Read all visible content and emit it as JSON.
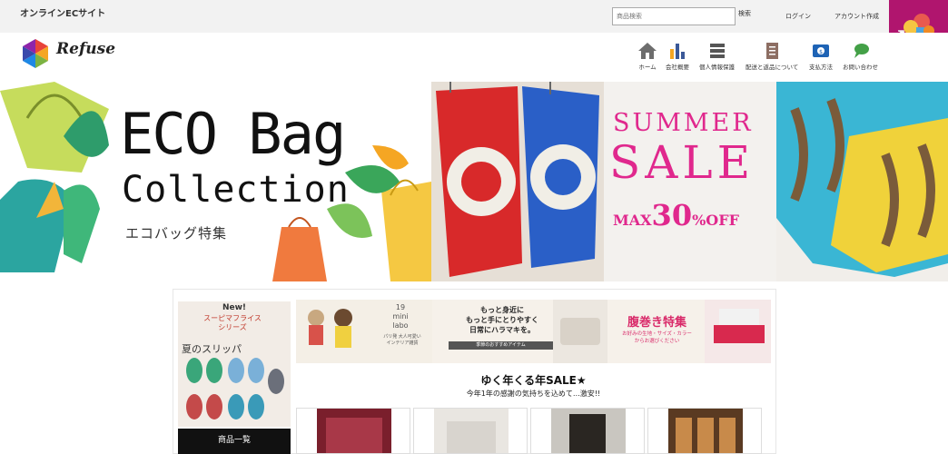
{
  "topbar": {
    "site_name": "オンラインECサイト",
    "search_placeholder": "商品検索",
    "search_button": "検索",
    "login": "ログイン",
    "signup": "アカウント作成"
  },
  "header": {
    "logo_text": "Refuse",
    "nav": [
      {
        "label": "ホーム",
        "icon": "home-icon"
      },
      {
        "label": "会社概要",
        "icon": "bar-chart-icon"
      },
      {
        "label": "個人情報保護",
        "icon": "list-icon"
      },
      {
        "label": "配送と返品について",
        "icon": "document-icon"
      },
      {
        "label": "支払方法",
        "icon": "payment-icon"
      },
      {
        "label": "お問い合わせ",
        "icon": "chat-icon"
      }
    ]
  },
  "banner": {
    "eco_title": "ECO Bag",
    "eco_subtitle": "Collection",
    "eco_jp": "エコバッグ特集",
    "summer": "SUMMER",
    "sale": "SALE",
    "max_prefix": "MAX",
    "max_value": "30",
    "max_suffix": "%OFF"
  },
  "side": {
    "new_label": "New!",
    "series": "スーピマフライス\nシリーズ",
    "slipper": "夏のスリッパ",
    "menu_button": "商品一覧"
  },
  "mid_banner": {
    "brand_num": "19",
    "brand_name": "mini\nlabo",
    "brand_jp": "パリ発 大人可愛い\nインテリア雑貨",
    "haramaki_copy": "もっと身近に\nもっと手にとりやすく\n日常にハラマキを。",
    "haramaki_tag": "季節のおすすめアイテム",
    "feature_title": "腹巻き特集",
    "feature_sub": "お好みの生地・サイズ・カラー\nからお選びください"
  },
  "sale_section": {
    "heading": "ゆく年くる年SALE★",
    "subheading": "今年1年の感謝の気持ちを込めて…激安!!"
  },
  "colors": {
    "cart_bg": "#b0156e",
    "sale_pink": "#e0288d",
    "topbar_bg": "#f2f2f2"
  }
}
